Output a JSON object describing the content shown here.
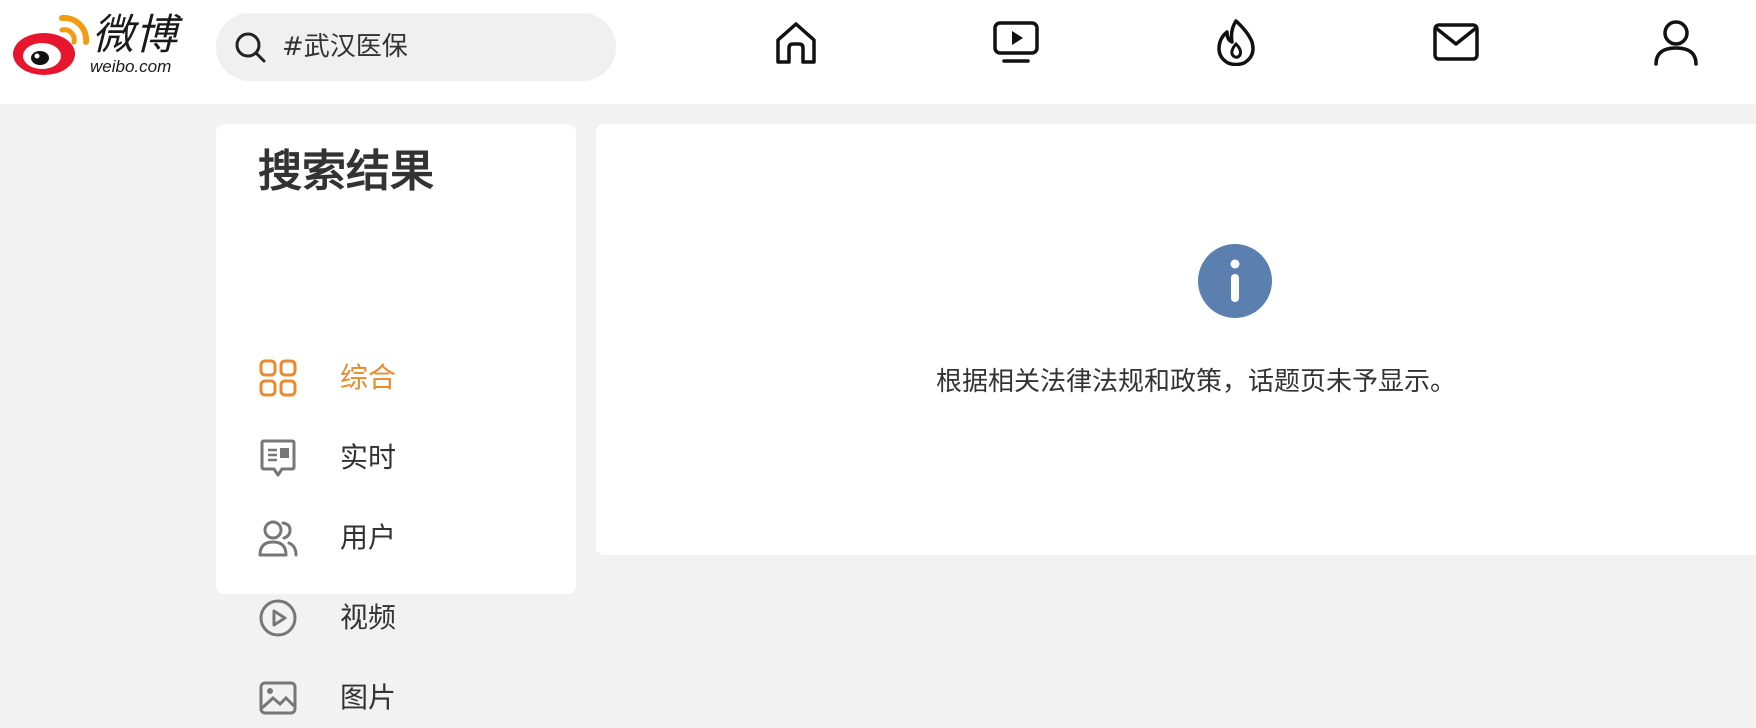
{
  "header": {
    "logo_text": "微博",
    "logo_sub": "weibo.com",
    "search": {
      "value": "#武汉医保",
      "icon": "search-icon"
    },
    "nav": [
      {
        "name": "home",
        "icon": "home-icon"
      },
      {
        "name": "video",
        "icon": "video-icon"
      },
      {
        "name": "hot",
        "icon": "flame-icon"
      },
      {
        "name": "messages",
        "icon": "mail-icon"
      },
      {
        "name": "profile",
        "icon": "user-icon"
      }
    ]
  },
  "sidebar": {
    "title": "搜索结果",
    "items": [
      {
        "label": "综合",
        "icon": "grid-icon",
        "active": true
      },
      {
        "label": "实时",
        "icon": "realtime-icon",
        "active": false
      },
      {
        "label": "用户",
        "icon": "users-icon",
        "active": false
      },
      {
        "label": "视频",
        "icon": "play-icon",
        "active": false
      },
      {
        "label": "图片",
        "icon": "image-icon",
        "active": false
      }
    ]
  },
  "main": {
    "icon": "info-icon",
    "notice": "根据相关法律法规和政策，话题页未予显示。"
  },
  "colors": {
    "accent": "#e88a2e",
    "info": "#5b7fae",
    "logo_red": "#e6162d",
    "logo_orange": "#f39c12",
    "background": "#f2f2f2"
  }
}
